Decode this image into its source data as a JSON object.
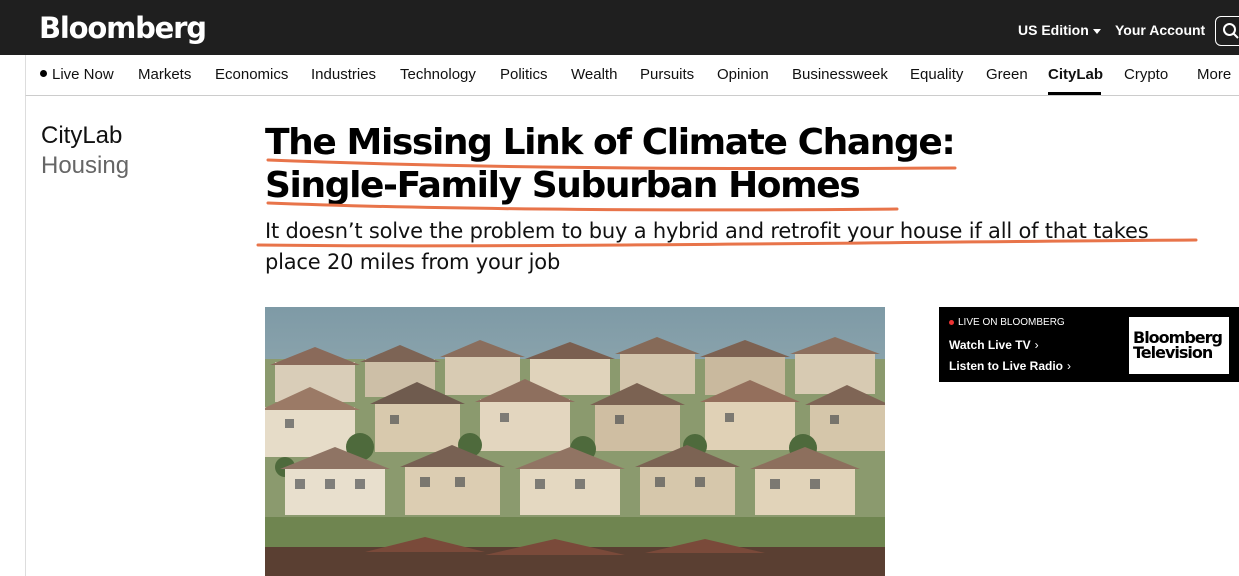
{
  "header": {
    "logo": "Bloomberg",
    "edition": "US Edition",
    "account": "Your Account"
  },
  "nav": {
    "items": [
      "Live Now",
      "Markets",
      "Economics",
      "Industries",
      "Technology",
      "Politics",
      "Wealth",
      "Pursuits",
      "Opinion",
      "Businessweek",
      "Equality",
      "Green",
      "CityLab",
      "Crypto",
      "More"
    ],
    "active": "CityLab"
  },
  "article": {
    "section": "CityLab",
    "subsection": "Housing",
    "headline_line1": "The Missing Link of Climate Change:",
    "headline_line2": "Single-Family Suburban Homes",
    "dek_line1": "It doesn’t solve the problem to buy a hybrid and retrofit your house if all of that takes",
    "dek_line2": "place 20 miles from your job",
    "annotation_color": "#e8744a"
  },
  "live_box": {
    "label": "LIVE ON BLOOMBERG",
    "watch": "Watch Live TV",
    "listen": "Listen to Live Radio",
    "logo_line1": "Bloomberg",
    "logo_line2": "Television"
  },
  "icons": {
    "search": "search-icon",
    "chevron": "chevron-right-icon",
    "caret": "caret-down-icon"
  }
}
